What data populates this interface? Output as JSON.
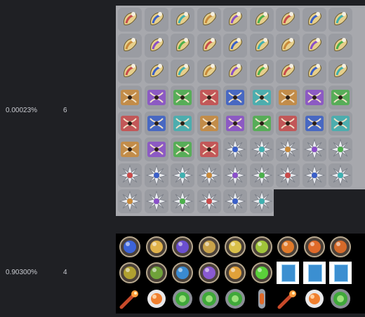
{
  "rows": [
    {
      "rate": "0.00023%",
      "count": "6"
    },
    {
      "rate": "0.90300%",
      "count": "4"
    }
  ],
  "colors": {
    "page_bg": "#1f2024",
    "sheet_bg": "#a7a8ad",
    "atlas_bg": "#000000",
    "text": "#c9cbd1"
  },
  "sheet_icons": [
    [
      "scroll-icon",
      "scroll-icon",
      "scroll-icon",
      "scroll-icon",
      "scroll-icon",
      "scroll-icon",
      "scroll-icon",
      "scroll-icon",
      "scroll-icon"
    ],
    [
      "scroll-icon",
      "scroll-icon",
      "scroll-icon",
      "scroll-icon",
      "scroll-icon",
      "scroll-icon",
      "scroll-icon",
      "scroll-icon",
      "scroll-icon"
    ],
    [
      "scroll-icon",
      "scroll-icon",
      "scroll-icon",
      "scroll-icon",
      "scroll-icon",
      "scroll-icon",
      "scroll-icon",
      "scroll-icon",
      "scroll-icon"
    ],
    [
      "rune-icon",
      "rune-icon",
      "rune-icon",
      "rune-icon",
      "rune-icon",
      "rune-icon",
      "rune-icon",
      "rune-icon",
      "rune-icon"
    ],
    [
      "rune-icon",
      "rune-icon",
      "rune-icon",
      "rune-icon",
      "rune-icon",
      "rune-icon",
      "rune-icon",
      "rune-icon",
      "rune-icon"
    ],
    [
      "rune-icon",
      "rune-icon",
      "rune-icon",
      "rune-icon",
      "flower-icon",
      "flower-icon",
      "flower-icon",
      "flower-icon",
      "flower-icon"
    ],
    [
      "flower-icon",
      "flower-icon",
      "flower-icon",
      "flower-icon",
      "flower-icon",
      "flower-icon",
      "flower-icon",
      "flower-icon",
      "flower-icon"
    ],
    [
      "flower-icon",
      "flower-icon",
      "flower-icon",
      "flower-icon",
      "flower-icon",
      "flower-icon"
    ]
  ],
  "atlas_icons": [
    [
      "orb-icon",
      "orb-icon",
      "orb-icon",
      "orb-icon",
      "orb-icon",
      "orb-icon",
      "orb-icon",
      "orb-icon",
      "orb-icon"
    ],
    [
      "orb-icon",
      "orb-icon",
      "orb-icon",
      "orb-icon",
      "orb-icon",
      "orb-icon",
      "card-icon",
      "card-icon",
      "card-icon"
    ],
    [
      "comet-icon",
      "ring-icon",
      "eye-icon",
      "eye-icon",
      "eye-icon",
      "capsule-icon",
      "comet-icon",
      "ring-icon",
      "eye-icon"
    ]
  ]
}
